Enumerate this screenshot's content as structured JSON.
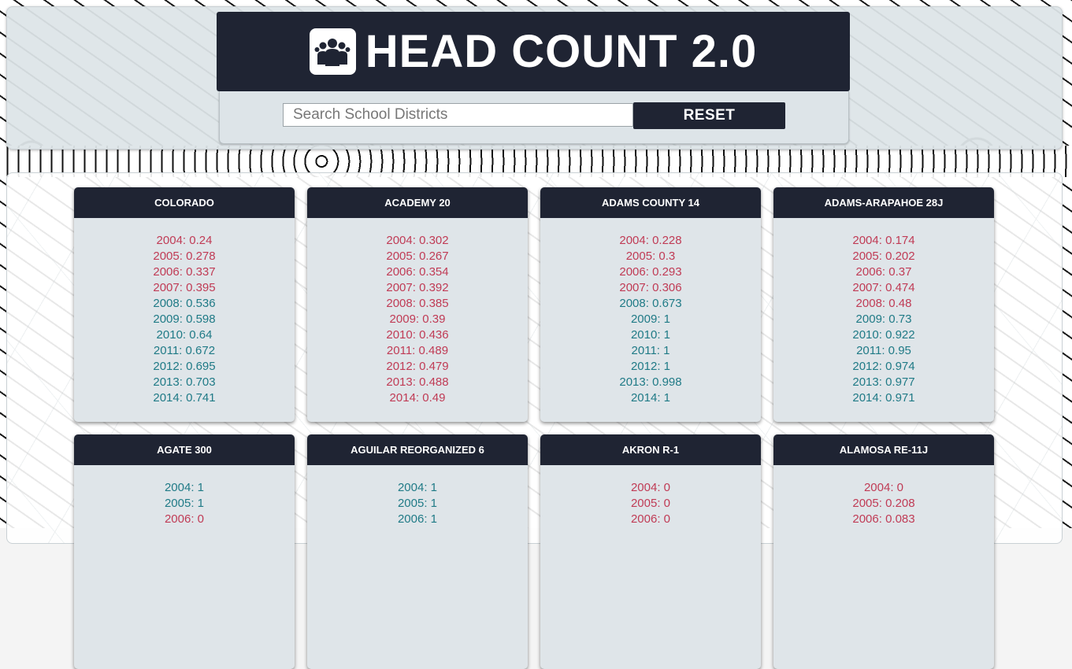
{
  "app": {
    "title": "HEAD COUNT 2.0",
    "logo_icon": "people-group-icon"
  },
  "search": {
    "placeholder": "Search School Districts",
    "value": "",
    "reset_label": "RESET"
  },
  "colors": {
    "dark": "#1f2433",
    "below_half": "#c03b55",
    "above_half": "#1f7a86",
    "card_bg": "#dfe5e9"
  },
  "districts": [
    {
      "name": "COLORADO",
      "rows": [
        {
          "label": "2004: 0.24",
          "level": "low"
        },
        {
          "label": "2005: 0.278",
          "level": "low"
        },
        {
          "label": "2006: 0.337",
          "level": "low"
        },
        {
          "label": "2007: 0.395",
          "level": "low"
        },
        {
          "label": "2008: 0.536",
          "level": "high"
        },
        {
          "label": "2009: 0.598",
          "level": "high"
        },
        {
          "label": "2010: 0.64",
          "level": "high"
        },
        {
          "label": "2011: 0.672",
          "level": "high"
        },
        {
          "label": "2012: 0.695",
          "level": "high"
        },
        {
          "label": "2013: 0.703",
          "level": "high"
        },
        {
          "label": "2014: 0.741",
          "level": "high"
        }
      ]
    },
    {
      "name": "ACADEMY 20",
      "rows": [
        {
          "label": "2004: 0.302",
          "level": "low"
        },
        {
          "label": "2005: 0.267",
          "level": "low"
        },
        {
          "label": "2006: 0.354",
          "level": "low"
        },
        {
          "label": "2007: 0.392",
          "level": "low"
        },
        {
          "label": "2008: 0.385",
          "level": "low"
        },
        {
          "label": "2009: 0.39",
          "level": "low"
        },
        {
          "label": "2010: 0.436",
          "level": "low"
        },
        {
          "label": "2011: 0.489",
          "level": "low"
        },
        {
          "label": "2012: 0.479",
          "level": "low"
        },
        {
          "label": "2013: 0.488",
          "level": "low"
        },
        {
          "label": "2014: 0.49",
          "level": "low"
        }
      ]
    },
    {
      "name": "ADAMS COUNTY 14",
      "rows": [
        {
          "label": "2004: 0.228",
          "level": "low"
        },
        {
          "label": "2005: 0.3",
          "level": "low"
        },
        {
          "label": "2006: 0.293",
          "level": "low"
        },
        {
          "label": "2007: 0.306",
          "level": "low"
        },
        {
          "label": "2008: 0.673",
          "level": "high"
        },
        {
          "label": "2009: 1",
          "level": "high"
        },
        {
          "label": "2010: 1",
          "level": "high"
        },
        {
          "label": "2011: 1",
          "level": "high"
        },
        {
          "label": "2012: 1",
          "level": "high"
        },
        {
          "label": "2013: 0.998",
          "level": "high"
        },
        {
          "label": "2014: 1",
          "level": "high"
        }
      ]
    },
    {
      "name": "ADAMS-ARAPAHOE 28J",
      "rows": [
        {
          "label": "2004: 0.174",
          "level": "low"
        },
        {
          "label": "2005: 0.202",
          "level": "low"
        },
        {
          "label": "2006: 0.37",
          "level": "low"
        },
        {
          "label": "2007: 0.474",
          "level": "low"
        },
        {
          "label": "2008: 0.48",
          "level": "low"
        },
        {
          "label": "2009: 0.73",
          "level": "high"
        },
        {
          "label": "2010: 0.922",
          "level": "high"
        },
        {
          "label": "2011: 0.95",
          "level": "high"
        },
        {
          "label": "2012: 0.974",
          "level": "high"
        },
        {
          "label": "2013: 0.977",
          "level": "high"
        },
        {
          "label": "2014: 0.971",
          "level": "high"
        }
      ]
    },
    {
      "name": "AGATE 300",
      "rows": [
        {
          "label": "2004: 1",
          "level": "high"
        },
        {
          "label": "2005: 1",
          "level": "high"
        },
        {
          "label": "2006: 0",
          "level": "low"
        }
      ]
    },
    {
      "name": "AGUILAR REORGANIZED 6",
      "rows": [
        {
          "label": "2004: 1",
          "level": "high"
        },
        {
          "label": "2005: 1",
          "level": "high"
        },
        {
          "label": "2006: 1",
          "level": "high"
        }
      ]
    },
    {
      "name": "AKRON R-1",
      "rows": [
        {
          "label": "2004: 0",
          "level": "low"
        },
        {
          "label": "2005: 0",
          "level": "low"
        },
        {
          "label": "2006: 0",
          "level": "low"
        }
      ]
    },
    {
      "name": "ALAMOSA RE-11J",
      "rows": [
        {
          "label": "2004: 0",
          "level": "low"
        },
        {
          "label": "2005: 0.208",
          "level": "low"
        },
        {
          "label": "2006: 0.083",
          "level": "low"
        }
      ]
    }
  ]
}
